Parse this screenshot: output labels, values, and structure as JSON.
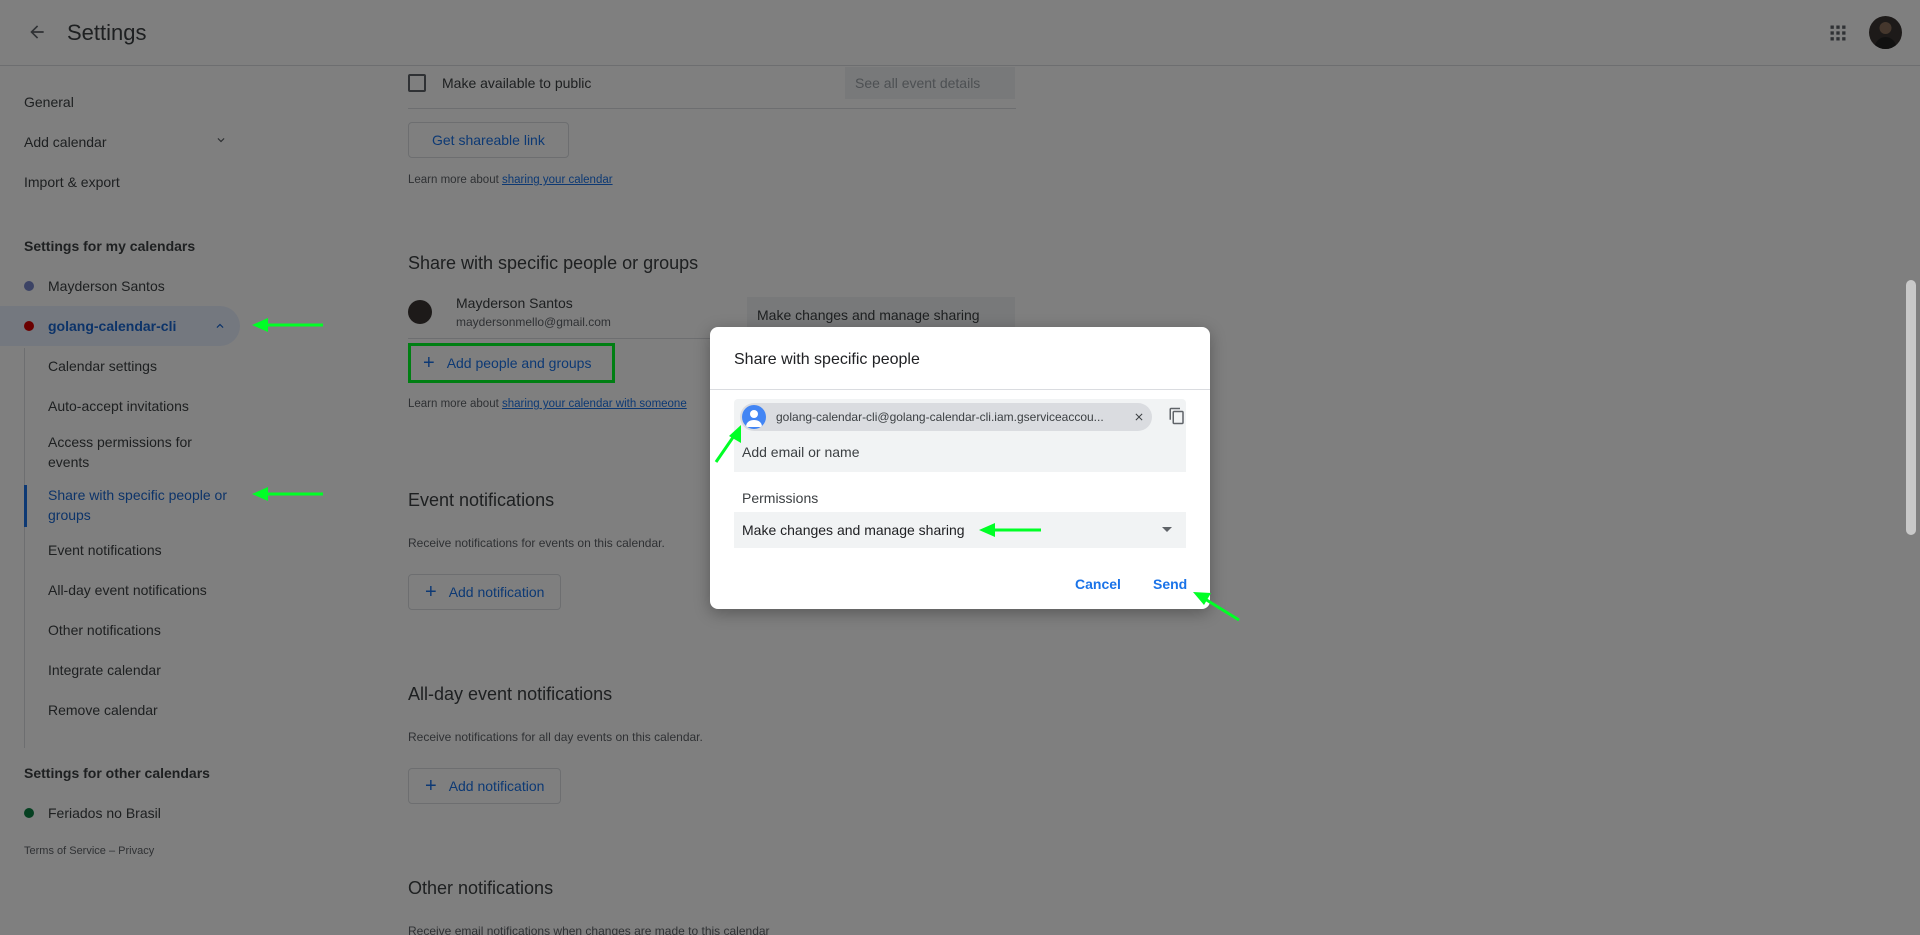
{
  "header": {
    "title": "Settings"
  },
  "sidebar": {
    "general": "General",
    "add_calendar": "Add calendar",
    "import_export": "Import & export",
    "my_calendars_heading": "Settings for my calendars",
    "my_calendars": [
      {
        "label": "Mayderson Santos",
        "color": "#7986cb"
      },
      {
        "label": "golang-calendar-cli",
        "color": "#d50000"
      }
    ],
    "sub_items": [
      "Calendar settings",
      "Auto-accept invitations",
      "Access permissions for events",
      "Share with specific people or groups",
      "Event notifications",
      "All-day event notifications",
      "Other notifications",
      "Integrate calendar",
      "Remove calendar"
    ],
    "other_calendars_heading": "Settings for other calendars",
    "other_calendars": [
      {
        "label": "Feriados no Brasil",
        "color": "#0b8043"
      }
    ],
    "footer": "Terms of Service – Privacy"
  },
  "main": {
    "make_public_label": "Make available to public",
    "public_select_value": "See all event details",
    "get_link_button": "Get shareable link",
    "learn_sharing_prefix": "Learn more about ",
    "learn_sharing_link": "sharing your calendar",
    "share_section_title": "Share with specific people or groups",
    "person_name": "Mayderson Santos",
    "person_email": "maydersonmello@gmail.com",
    "person_permission": "Make changes and manage sharing",
    "add_people_button": "Add people and groups",
    "learn_share_someone_prefix": "Learn more about ",
    "learn_share_someone_link": "sharing your calendar with someone",
    "event_notifications_title": "Event notifications",
    "event_notifications_desc": "Receive notifications for events on this calendar.",
    "add_notification_button": "Add notification",
    "allday_title": "All-day event notifications",
    "allday_desc": "Receive notifications for all day events on this calendar.",
    "add_notification_button_2": "Add notification",
    "other_title": "Other notifications",
    "other_desc": "Receive email notifications when changes are made to this calendar"
  },
  "dialog": {
    "title": "Share with specific people",
    "chip_email": "golang-calendar-cli@golang-calendar-cli.iam.gserviceaccou...",
    "input_placeholder": "Add email or name",
    "permissions_label": "Permissions",
    "permissions_value": "Make changes and manage sharing",
    "cancel_button": "Cancel",
    "send_button": "Send"
  },
  "colors": {
    "accent": "#1a73e8",
    "annotation": "#00ff26"
  }
}
